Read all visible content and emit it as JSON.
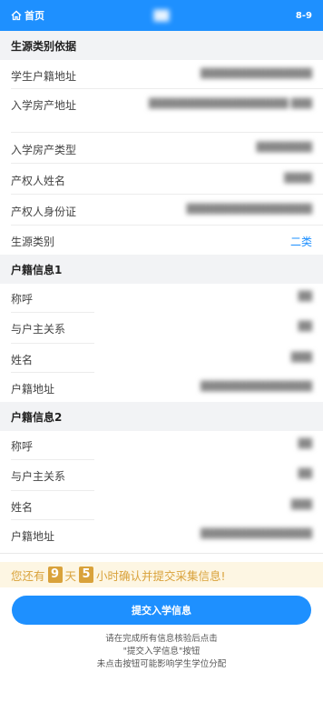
{
  "topbar": {
    "home_label": "首页",
    "title": "██",
    "version": "8-9"
  },
  "sections": [
    {
      "title": "生源类别依据",
      "rows": [
        {
          "label": "学生户籍地址",
          "value": "████████████████"
        },
        {
          "label": "入学房产地址",
          "value": "████████████████████ ███"
        },
        {
          "label": "入学房产类型",
          "value": "████████"
        },
        {
          "label": "产权人姓名",
          "value": "████"
        },
        {
          "label": "产权人身份证",
          "value": "██████████████████"
        },
        {
          "label": "生源类别",
          "value": "二类"
        }
      ]
    },
    {
      "title": "户籍信息1",
      "rows": [
        {
          "label": "称呼",
          "value": "██"
        },
        {
          "label": "与户主关系",
          "value": "██"
        },
        {
          "label": "姓名",
          "value": "███"
        },
        {
          "label": "户籍地址",
          "value": "████████████████"
        }
      ]
    },
    {
      "title": "户籍信息2",
      "rows": [
        {
          "label": "称呼",
          "value": "██"
        },
        {
          "label": "与户主关系",
          "value": "██"
        },
        {
          "label": "姓名",
          "value": "███"
        },
        {
          "label": "户籍地址",
          "value": "████████████████"
        }
      ]
    }
  ],
  "notice": {
    "prefix": "您还有",
    "days": "9",
    "day_unit": "天",
    "hours": "5",
    "suffix": "小时确认并提交采集信息!"
  },
  "submit_label": "提交入学信息",
  "hint": {
    "line1": "请在完成所有信息核验后点击",
    "line2": "\"提交入学信息\"按钮",
    "line3": "未点击按钮可能影响学生学位分配"
  },
  "colors": {
    "primary": "#1e90ff",
    "notice_bg": "#fdf6e3",
    "notice_text": "#d9a23b",
    "section_bg": "#f2f3f5"
  }
}
